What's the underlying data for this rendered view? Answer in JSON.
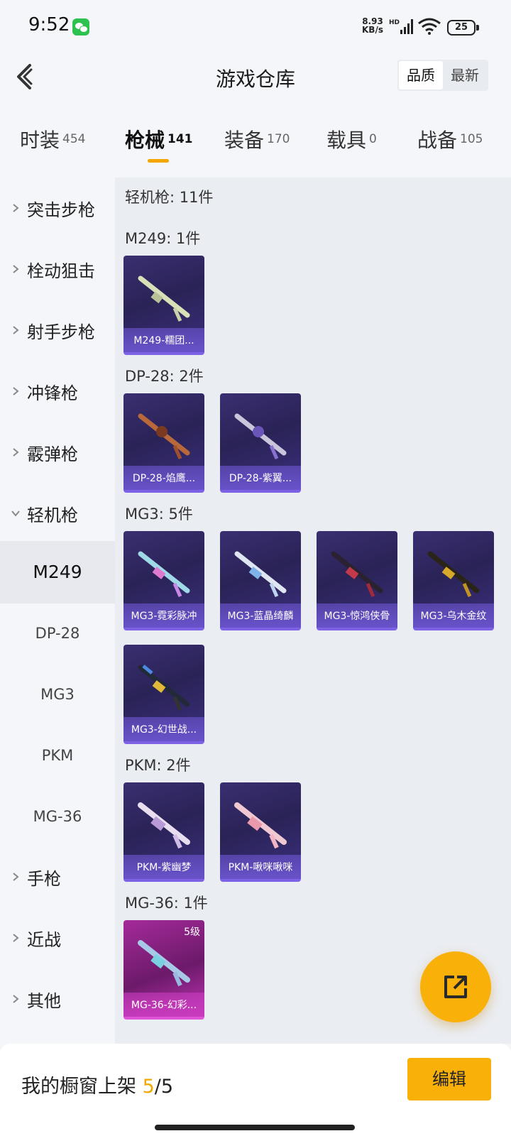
{
  "status_bar": {
    "time": "9:52",
    "net_speed_value": "8.93",
    "net_speed_unit": "KB/s",
    "network_type": "HD",
    "battery": "25",
    "icons": [
      "wechat-icon",
      "signal-icon",
      "wifi-icon",
      "battery-icon"
    ]
  },
  "header": {
    "title": "游戏仓库",
    "sort_options": [
      "品质",
      "最新"
    ],
    "sort_active": "品质"
  },
  "tabs": [
    {
      "label": "时装",
      "count": "454"
    },
    {
      "label": "枪械",
      "count": "141",
      "active": true
    },
    {
      "label": "装备",
      "count": "170"
    },
    {
      "label": "载具",
      "count": "0"
    },
    {
      "label": "战备",
      "count": "105"
    }
  ],
  "sidebar": {
    "categories": [
      {
        "label": "突击步枪",
        "expanded": false
      },
      {
        "label": "栓动狙击",
        "expanded": false
      },
      {
        "label": "射手步枪",
        "expanded": false
      },
      {
        "label": "冲锋枪",
        "expanded": false
      },
      {
        "label": "霰弹枪",
        "expanded": false
      },
      {
        "label": "轻机枪",
        "expanded": true
      }
    ],
    "subitems": [
      "M249",
      "DP-28",
      "MG3",
      "PKM",
      "MG-36"
    ],
    "active_sub": "M249",
    "after_categories": [
      {
        "label": "手枪"
      },
      {
        "label": "近战"
      },
      {
        "label": "其他"
      }
    ]
  },
  "content": {
    "summary": "轻机枪: 11件",
    "sections": [
      {
        "title": "M249: 1件",
        "items": [
          "M249-糯团..."
        ]
      },
      {
        "title": "DP-28: 2件",
        "items": [
          "DP-28-焰鹰...",
          "DP-28-紫翼..."
        ]
      },
      {
        "title": "MG3: 5件",
        "items": [
          "MG3-霓彩脉冲",
          "MG3-蓝晶绮麟",
          "MG3-惊鸿侠骨",
          "MG3-乌木金纹",
          "MG3-幻世战..."
        ]
      },
      {
        "title": "PKM: 2件",
        "items": [
          "PKM-紫幽梦",
          "PKM-啾咪啾咪"
        ]
      },
      {
        "title": "MG-36: 1件",
        "items": [
          "MG-36-幻彩..."
        ],
        "level": "5级"
      }
    ]
  },
  "fab": {
    "icon": "share-icon"
  },
  "bottom": {
    "showcase_label": "我的橱窗上架",
    "showcase_current": "5",
    "showcase_total": "/5",
    "edit_label": "编辑"
  },
  "colors": {
    "accent": "#f9b10a",
    "card_purple": "#3a2f72",
    "card_pink": "#a52a9a"
  }
}
